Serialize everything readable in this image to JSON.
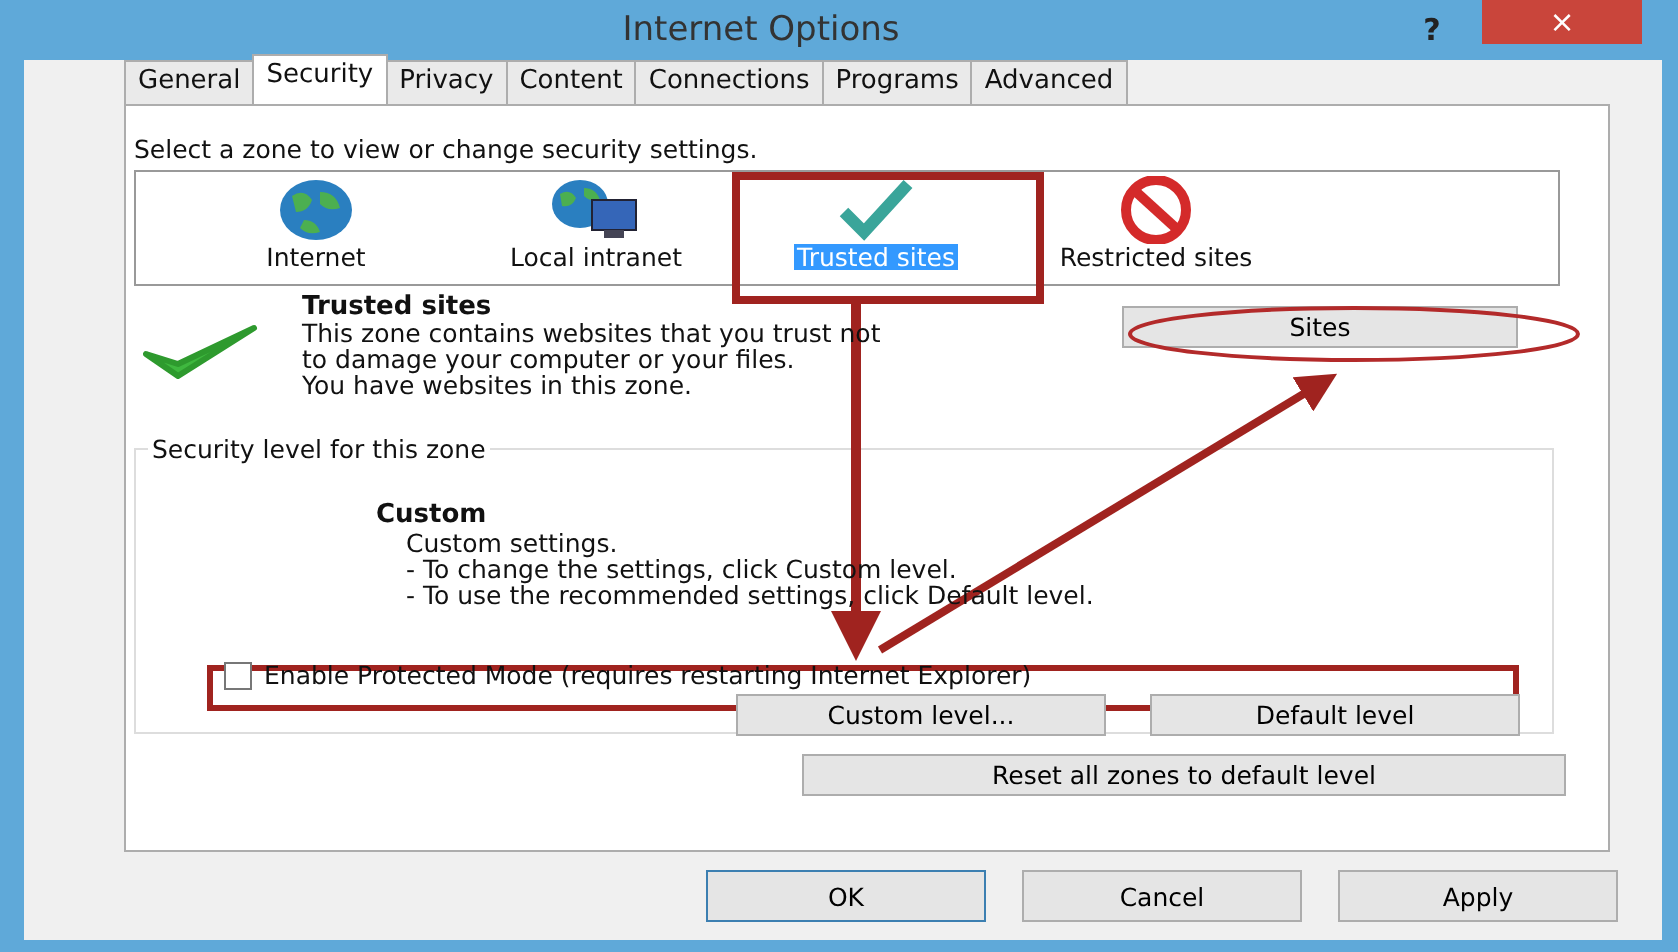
{
  "window": {
    "title": "Internet Options",
    "help_glyph": "?",
    "close_glyph": "×"
  },
  "tabs": [
    {
      "label": "General",
      "selected": false
    },
    {
      "label": "Security",
      "selected": true
    },
    {
      "label": "Privacy",
      "selected": false
    },
    {
      "label": "Content",
      "selected": false
    },
    {
      "label": "Connections",
      "selected": false
    },
    {
      "label": "Programs",
      "selected": false
    },
    {
      "label": "Advanced",
      "selected": false
    }
  ],
  "zone_prompt": "Select a zone to view or change security settings.",
  "zones": [
    {
      "label": "Internet",
      "kind": "globe",
      "selected": false
    },
    {
      "label": "Local intranet",
      "kind": "intranet",
      "selected": false
    },
    {
      "label": "Trusted sites",
      "kind": "check",
      "selected": true
    },
    {
      "label": "Restricted sites",
      "kind": "blocked",
      "selected": false
    }
  ],
  "zone_info": {
    "title": "Trusted sites",
    "description": "This zone contains websites that you trust not to damage your computer or your files.",
    "status": "You have websites in this zone."
  },
  "sites_button": "Sites",
  "security_level": {
    "legend": "Security level for this zone",
    "level_name": "Custom",
    "lines": [
      "Custom settings.",
      "- To change the settings, click Custom level.",
      "- To use the recommended settings, click Default level."
    ]
  },
  "protected_mode": {
    "label": "Enable Protected Mode (requires restarting Internet Explorer)",
    "checked": false
  },
  "level_buttons": [
    "Custom level...",
    "Default level"
  ],
  "reset_button": "Reset all zones to default level",
  "dialog_buttons": [
    {
      "label": "OK",
      "default": true
    },
    {
      "label": "Cancel",
      "default": false
    },
    {
      "label": "Apply",
      "default": false
    }
  ]
}
